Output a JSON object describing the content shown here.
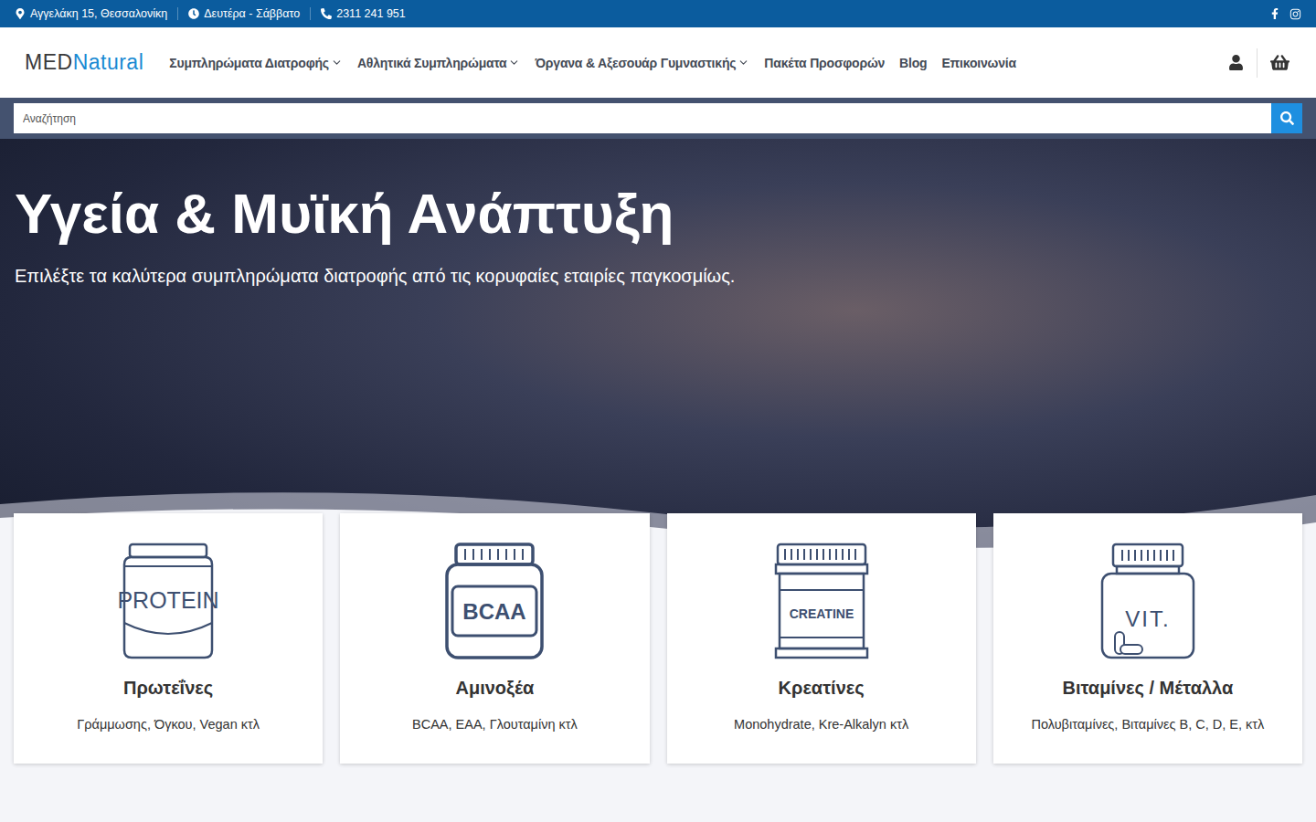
{
  "topbar": {
    "address": "Αγγελάκη 15, Θεσσαλονίκη",
    "hours": "Δευτέρα - Σάββατο",
    "phone": "2311 241 951"
  },
  "header": {
    "logo": {
      "part1": "MED",
      "part2": "Natural"
    },
    "nav": [
      {
        "label": "Συμπληρώματα Διατροφής",
        "dropdown": true
      },
      {
        "label": "Αθλητικά Συμπληρώματα",
        "dropdown": true
      },
      {
        "label": "Όργανα & Αξεσουάρ Γυμναστικής",
        "dropdown": true
      },
      {
        "label": "Πακέτα Προσφορών",
        "dropdown": false
      },
      {
        "label": "Blog",
        "dropdown": false
      },
      {
        "label": "Επικοινωνία",
        "dropdown": false
      }
    ]
  },
  "search": {
    "placeholder": "Αναζήτηση"
  },
  "hero": {
    "title": "Υγεία & Μυϊκή Ανάπτυξη",
    "subtitle": "Επιλέξτε τα καλύτερα συμπληρώματα διατροφής από τις κορυφαίες εταιρίες παγκοσμίως."
  },
  "categories": [
    {
      "title": "Πρωτεΐνες",
      "subtitle": "Γράμμωσης, Όγκου, Vegan κτλ",
      "icon_label": "PROTEIN",
      "kind": "tub"
    },
    {
      "title": "Αμινοξέα",
      "subtitle": "BCAA, EAA, Γλουταμίνη κτλ",
      "icon_label": "BCAA",
      "kind": "jar"
    },
    {
      "title": "Κρεατίνες",
      "subtitle": "Monohydrate, Kre-Alkalyn κτλ",
      "icon_label": "CREATINE",
      "kind": "tall"
    },
    {
      "title": "Βιταμίνες / Μέταλλα",
      "subtitle": "Πολυβιταμίνες, Βιταμίνες B, C, D, E, κτλ",
      "icon_label": "VIT.",
      "kind": "bottle"
    }
  ]
}
